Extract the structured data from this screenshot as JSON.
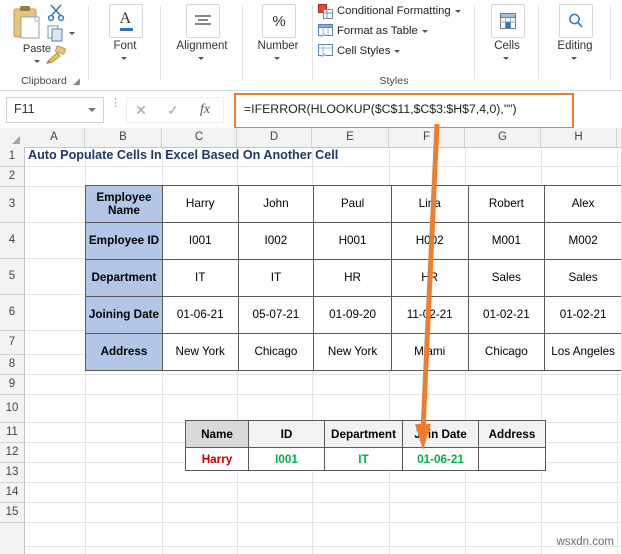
{
  "ribbon": {
    "groups": [
      {
        "name": "clipboard",
        "label": "Clipboard"
      },
      {
        "name": "font",
        "label": "Font"
      },
      {
        "name": "alignment",
        "label": "Alignment"
      },
      {
        "name": "number",
        "label": "Number"
      },
      {
        "name": "styles",
        "label": "Styles"
      },
      {
        "name": "cells",
        "label": "Cells"
      },
      {
        "name": "editing",
        "label": "Editing"
      }
    ],
    "paste_label": "Paste",
    "font_label": "Font",
    "alignment_label": "Alignment",
    "number_label": "Number",
    "number_glyph": "%",
    "font_glyph": "A",
    "cells_label": "Cells",
    "editing_label": "Editing",
    "styles_items": [
      {
        "label": "Conditional Formatting",
        "icon": "conditional-formatting-icon"
      },
      {
        "label": "Format as Table",
        "icon": "format-as-table-icon"
      },
      {
        "label": "Cell Styles",
        "icon": "cell-styles-icon"
      }
    ]
  },
  "formula_bar": {
    "name_box_value": "F11",
    "cancel_icon": "✕",
    "confirm_icon": "✓",
    "function_icon": "fx",
    "formula": "=IFERROR(HLOOKUP($C$11,$C$3:$H$7,4,0),\"\")",
    "highlight_color": "#ED7D31"
  },
  "grid": {
    "columns": [
      "A",
      "B",
      "C",
      "D",
      "E",
      "F",
      "G",
      "H"
    ],
    "rows": [
      "1",
      "2",
      "3",
      "4",
      "5",
      "6",
      "7",
      "8",
      "9",
      "10",
      "11",
      "12",
      "13",
      "14",
      "15"
    ],
    "title": "Auto Populate Cells In Excel Based On Another Cell",
    "title_color": "#1F3864"
  },
  "main_table": {
    "header_fill": "#B4C6E7",
    "rows": [
      {
        "label": "Employee Name",
        "values": [
          "Harry",
          "John",
          "Paul",
          "Lina",
          "Robert",
          "Alex"
        ]
      },
      {
        "label": "Employee ID",
        "values": [
          "I001",
          "I002",
          "H001",
          "H002",
          "M001",
          "M002"
        ]
      },
      {
        "label": "Department",
        "values": [
          "IT",
          "IT",
          "HR",
          "HR",
          "Sales",
          "Sales"
        ]
      },
      {
        "label": "Joining Date",
        "values": [
          "01-06-21",
          "05-07-21",
          "01-09-20",
          "11-02-21",
          "01-02-21",
          "01-02-21"
        ]
      },
      {
        "label": "Address",
        "values": [
          "New York",
          "Chicago",
          "New York",
          "Miami",
          "Chicago",
          "Los Angeles"
        ]
      }
    ]
  },
  "result_table": {
    "headers": [
      "Name",
      "ID",
      "Department",
      "Join Date",
      "Address"
    ],
    "row": [
      "Harry",
      "I001",
      "IT",
      "01-06-21",
      ""
    ],
    "row_colors": [
      "#C00000",
      "#00B050",
      "#00B050",
      "#00B050",
      ""
    ]
  },
  "watermark": "wsxdn.com"
}
